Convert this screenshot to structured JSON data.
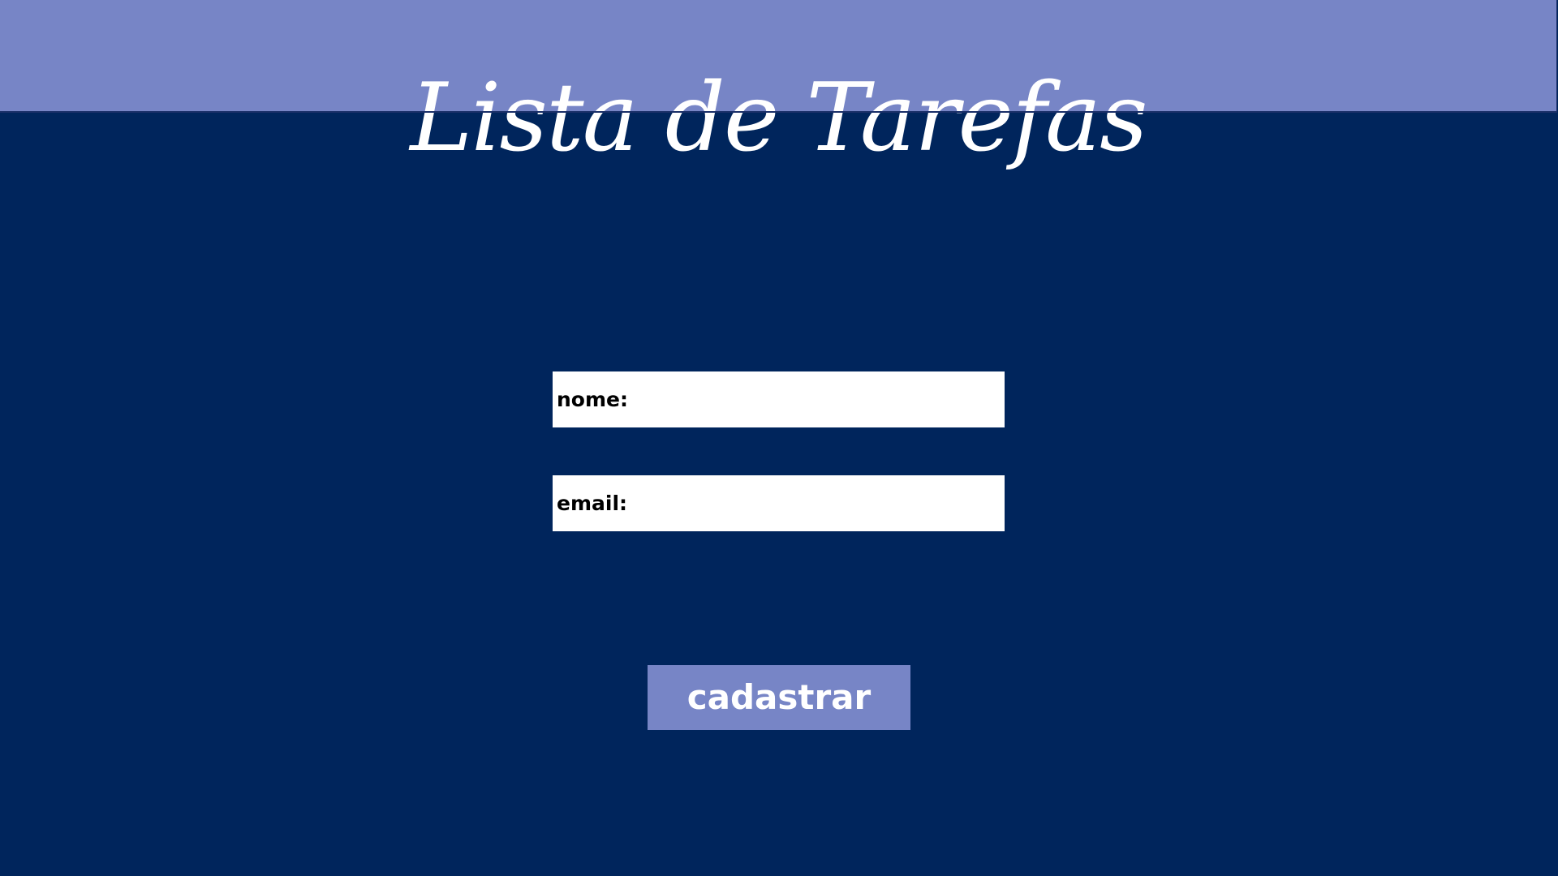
{
  "header": {
    "title": "Lista de Tarefas"
  },
  "form": {
    "name_label": "nome:",
    "name_value": "",
    "email_label": "email:",
    "email_value": "",
    "submit_label": "cadastrar"
  },
  "colors": {
    "page_background": "#00255c",
    "header_background": "#7785c6",
    "input_background": "#ffffff",
    "button_background": "#7785c6",
    "button_text": "#ffffff"
  }
}
